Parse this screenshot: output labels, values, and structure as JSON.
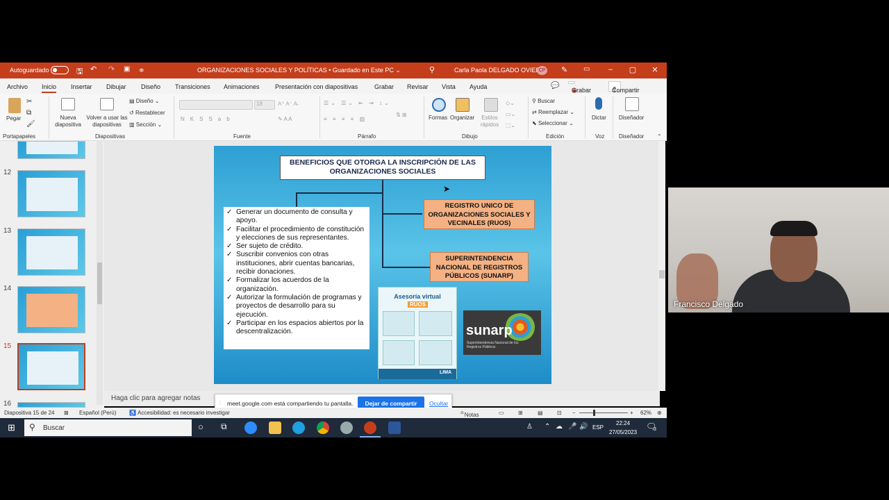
{
  "titlebar": {
    "autosave": "Autoguardado",
    "doc_title": "ORGANIZACIONES SOCIALES Y POLÍTICAS • Guardado en Este PC ⌄",
    "user": "Carla Paola DELGADO OVIEDO",
    "initials": "CP"
  },
  "menu": {
    "tabs": [
      "Archivo",
      "Inicio",
      "Insertar",
      "Dibujar",
      "Diseño",
      "Transiciones",
      "Animaciones",
      "Presentación con diapositivas",
      "Grabar",
      "Revisar",
      "Vista",
      "Ayuda"
    ],
    "grabar_button": "Grabar",
    "compartir_button": "Compartir"
  },
  "ribbon": {
    "pegar": "Pegar",
    "portapapeles": "Portapapeles",
    "nueva_diapositiva": "Nueva diapositiva",
    "volver": "Volver a usar las diapositivas",
    "diseno": "Diseño",
    "restablecer": "Restablecer",
    "seccion": "Sección",
    "diapositivas": "Diapositivas",
    "fuente": "Fuente",
    "font_size": "18",
    "parrafo": "Párrafo",
    "formas": "Formas",
    "organizar": "Organizar",
    "estilos": "Estilos rápidos",
    "dibujo": "Dibujo",
    "buscar": "Buscar",
    "reemplazar": "Reemplazar",
    "seleccionar": "Seleccionar",
    "edicion": "Edición",
    "dictar": "Dictar",
    "voz": "Voz",
    "disenador": "Diseñador",
    "disenador_group": "Diseñador"
  },
  "thumbs": {
    "numbers": [
      "12",
      "13",
      "14",
      "15",
      "16"
    ]
  },
  "slide": {
    "title": "BENEFICIOS QUE OTORGA LA INSCRIPCIÓN DE LAS ORGANIZACIONES SOCIALES",
    "benefits": [
      "Generar un documento de consulta y apoyo.",
      "Facilitar el procedimiento de constitución y elecciones de sus representantes.",
      "Ser sujeto de crédito.",
      "Suscribir convenios con otras instituciones, abrir cuentas bancarias, recibir donaciones.",
      "Formalizar los acuerdos de la organización.",
      "Autorizar la formulación de programas y proyectos de desarrollo para su ejecución.",
      "Participar en los espacios abiertos por la descentralización."
    ],
    "box_ruos": "REGISTRO UNICO DE ORGANIZACIONES SOCIALES Y VECINALES (RUOS)",
    "box_sunarp": "SUPERINTENDENCIA NACIONAL DE REGISTROS PÚBLICOS (SUNARP)",
    "ruos_title": "Asesoría virtual",
    "ruos_badge": "RUOS",
    "ruos_footer": "LIMA",
    "sunarp_logo": "sunarp",
    "sunarp_sub": "Superintendencia Nacional de los Registros Públicos"
  },
  "notes": {
    "placeholder": "Haga clic para agregar notas"
  },
  "sharebar": {
    "message": "meet.google.com está compartiendo tu pantalla.",
    "stop": "Dejar de compartir",
    "hide": "Ocultar"
  },
  "status": {
    "slide_info": "Diapositiva 15 de 24",
    "language": "Español (Perú)",
    "accessibility": "Accesibilidad: es necesario investigar",
    "notas": "Notas",
    "zoom": "62%"
  },
  "taskbar": {
    "search_placeholder": "Buscar",
    "lang": "ESP",
    "time": "22:24",
    "date": "27/05/2023",
    "notif_count": "3"
  },
  "video": {
    "participant_name": "Francisco Delgado"
  }
}
